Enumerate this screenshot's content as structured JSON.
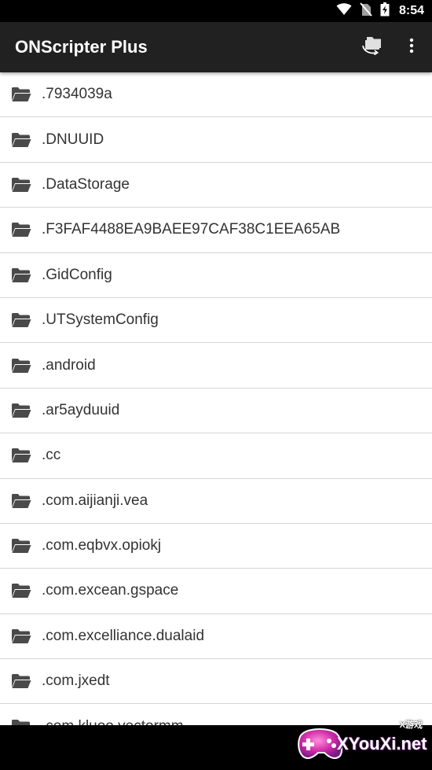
{
  "status_bar": {
    "time": "8:54",
    "icons": [
      "wifi-icon",
      "no-sim-icon",
      "battery-charging-icon"
    ]
  },
  "toolbar": {
    "title": "ONScripter Plus",
    "actions": [
      "switch-storage-icon",
      "more-vert-icon"
    ]
  },
  "files": [
    {
      "name": ".7934039a",
      "icon": "folder-icon"
    },
    {
      "name": ".DNUUID",
      "icon": "folder-icon"
    },
    {
      "name": ".DataStorage",
      "icon": "folder-icon"
    },
    {
      "name": ".F3FAF4488EA9BAEE97CAF38C1EEA65AB",
      "icon": "folder-icon"
    },
    {
      "name": ".GidConfig",
      "icon": "folder-icon"
    },
    {
      "name": ".UTSystemConfig",
      "icon": "folder-icon"
    },
    {
      "name": ".android",
      "icon": "folder-icon"
    },
    {
      "name": ".ar5ayduuid",
      "icon": "folder-icon"
    },
    {
      "name": ".cc",
      "icon": "folder-icon"
    },
    {
      "name": ".com.aijianji.vea",
      "icon": "folder-icon"
    },
    {
      "name": ".com.eqbvx.opiokj",
      "icon": "folder-icon"
    },
    {
      "name": ".com.excean.gspace",
      "icon": "folder-icon"
    },
    {
      "name": ".com.excelliance.dualaid",
      "icon": "folder-icon"
    },
    {
      "name": ".com.jxedt",
      "icon": "folder-icon"
    },
    {
      "name": ".com.kluoo.vectormm",
      "icon": "folder-icon"
    }
  ],
  "watermark": {
    "main": "XYouXi.net",
    "small": "X游戏"
  },
  "colors": {
    "toolbar": "#212121",
    "status_bar": "#000000",
    "list_bg": "#ffffff",
    "divider": "#d6d6d6",
    "text": "#333333"
  }
}
